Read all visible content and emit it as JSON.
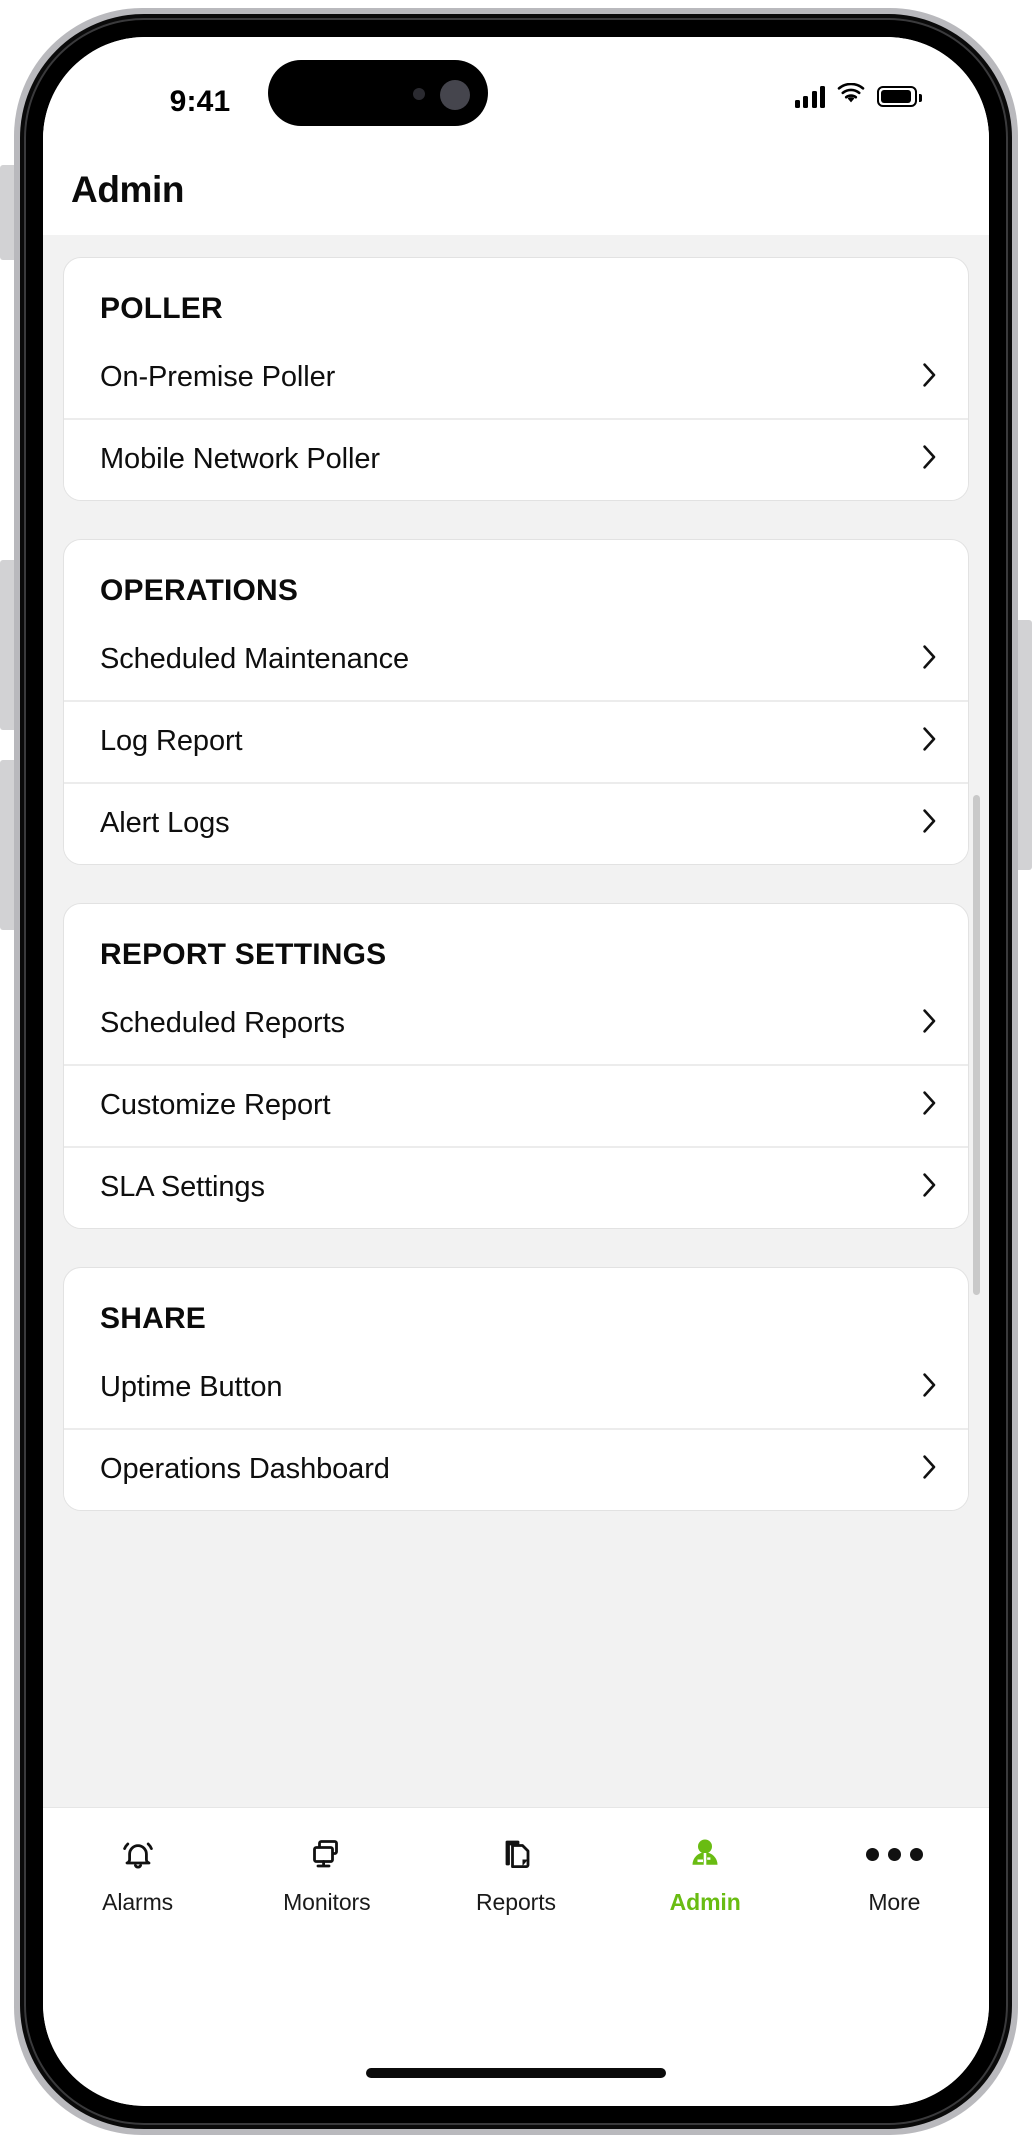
{
  "status_bar": {
    "time": "9:41",
    "cellular_icon": "cellular-signal-icon",
    "wifi_icon": "wifi-icon",
    "battery_icon": "battery-full-icon"
  },
  "header": {
    "title": "Admin"
  },
  "colors": {
    "accent_green": "#69bc12",
    "page_background": "#f2f2f2",
    "card_background": "#ffffff",
    "card_border": "#e2e2e2",
    "divider": "#ececec",
    "text_primary": "#0e0e0e",
    "chevron": "#111111"
  },
  "sections": [
    {
      "title": "POLLER",
      "rows": [
        {
          "label": "On-Premise Poller",
          "accessory": "chevron-right-icon"
        },
        {
          "label": "Mobile Network Poller",
          "accessory": "chevron-right-icon"
        }
      ]
    },
    {
      "title": "OPERATIONS",
      "rows": [
        {
          "label": "Scheduled Maintenance",
          "accessory": "chevron-right-icon"
        },
        {
          "label": "Log Report",
          "accessory": "chevron-right-icon"
        },
        {
          "label": "Alert Logs",
          "accessory": "chevron-right-icon"
        }
      ]
    },
    {
      "title": "REPORT SETTINGS",
      "rows": [
        {
          "label": "Scheduled Reports",
          "accessory": "chevron-right-icon"
        },
        {
          "label": "Customize Report",
          "accessory": "chevron-right-icon"
        },
        {
          "label": "SLA Settings",
          "accessory": "chevron-right-icon"
        }
      ]
    },
    {
      "title": "SHARE",
      "rows": [
        {
          "label": "Uptime Button",
          "accessory": "chevron-right-icon"
        },
        {
          "label": "Operations Dashboard",
          "accessory": "chevron-right-icon"
        }
      ]
    }
  ],
  "tab_bar": {
    "items": [
      {
        "label": "Alarms",
        "icon": "bell-icon",
        "active": false
      },
      {
        "label": "Monitors",
        "icon": "monitor-icon",
        "active": false
      },
      {
        "label": "Reports",
        "icon": "documents-icon",
        "active": false
      },
      {
        "label": "Admin",
        "icon": "user-admin-icon",
        "active": true
      },
      {
        "label": "More",
        "icon": "ellipsis-icon",
        "active": false
      }
    ]
  }
}
